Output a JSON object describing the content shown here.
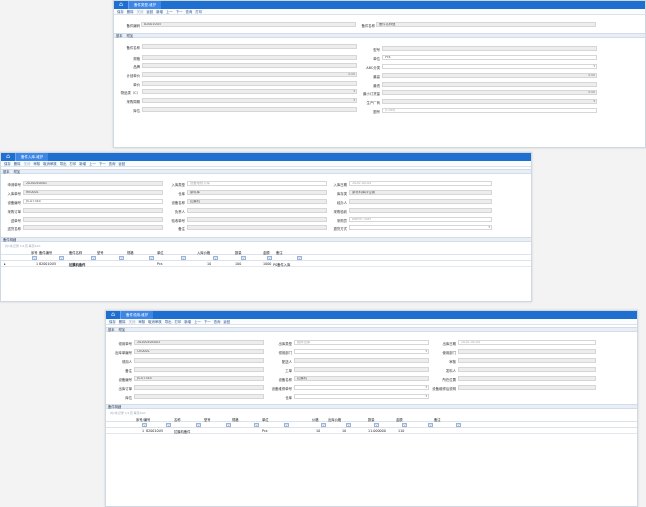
{
  "w1": {
    "tab": "备件类型-维护",
    "toolbar": [
      "保存",
      "删除",
      "关闭",
      "返回",
      "新增",
      "上一",
      "下一",
      "查询",
      "打印"
    ],
    "header": {
      "code_label": "备件编码",
      "code_value": "820010U5",
      "name_label": "备件名称",
      "name_value": "备件名称值"
    },
    "tabs": [
      "基本",
      "附加"
    ],
    "fields": {
      "l1": "备件名称",
      "l2": "规格",
      "l3": "品牌",
      "l4": "计划单价",
      "l5": "单价",
      "l6": "物品类（C）",
      "l7": "采购周期",
      "l8": "库位",
      "r1": "型号",
      "r2": "单位",
      "r3": "ABC分类",
      "r4": "最高",
      "r5": "最低",
      "r6": "最小订货量",
      "r7": "生产厂商",
      "r8": "图号",
      "r2v": "Pcs",
      "l4v": "0.00",
      "r4v": "0.00",
      "r6v": "0.00",
      "r8v": "(Char)"
    }
  },
  "w2": {
    "tab": "备件入库-维护",
    "toolbar": [
      "保存",
      "删除",
      "关闭",
      "审核",
      "取消审核",
      "导出",
      "打印",
      "新增",
      "上一",
      "下一",
      "查询",
      "返回"
    ],
    "tabs": [
      "基本",
      "附加"
    ],
    "fields": {
      "a1": "申请单号",
      "a1v": "2020040001",
      "b1": "入库类型",
      "b1v": "设备维修入库",
      "c1": "入库日期",
      "c1v": "2020-04-04",
      "a2": "入库单号",
      "a2v": "RK0001",
      "b2": "仓库",
      "b2v": "原料库",
      "c2": "库存类",
      "c2v": "原材料库存位置",
      "a3": "设备编号",
      "a3v": "JS-07344",
      "b3": "设备名称",
      "b3v": "拉膜机",
      "c3": "经办人",
      "a4": "采购订单",
      "b4": "负责人",
      "c4": "采购验收",
      "a5": "送单号",
      "b5": "验收单号",
      "c5": "采购员",
      "c5v": "Admin User",
      "a6": "送货名称",
      "b6": "备注",
      "c6": "退货方式"
    },
    "grid": {
      "title": "备件明细",
      "hint": "共1条记录  1/1页  每页100",
      "cols": [
        "序号",
        "备件编号",
        "备件名称",
        "型号",
        "规格",
        "单位",
        "入库价格",
        "数量",
        "金额",
        "备注"
      ],
      "row": {
        "seq": "1",
        "code": "820010U5",
        "name": "拉膜机备件",
        "unit": "Pcs",
        "price": "10",
        "qty": "100",
        "amount": "1000",
        "remark": "PS备件入库"
      }
    }
  },
  "w3": {
    "tab": "备件领用-维护",
    "toolbar": [
      "保存",
      "删除",
      "关闭",
      "审核",
      "取消审核",
      "导出",
      "打印",
      "新增",
      "上一",
      "下一",
      "查询",
      "返回"
    ],
    "tabs": [
      "基本",
      "附加"
    ],
    "fields": {
      "a1": "领用单号",
      "a1v": "20200404003",
      "b1": "出库类型",
      "b1v": "维修出库",
      "c1": "出库日期",
      "c1v": "2020-04-04",
      "a2": "出库单编号",
      "a2v": "CK0001",
      "b2": "领用部门",
      "c2": "使用部门",
      "a3": "领用人",
      "b3": "配送人",
      "c3": "审核",
      "a4": "备注",
      "b4": "工单",
      "c4": "发料人",
      "a5": "设备编号",
      "a5v": "JS-07344",
      "b5": "设备名称",
      "b5v": "拉膜机",
      "c5": "所在位置",
      "a6": "出库订单",
      "b6": "设备维修单号",
      "c6": "设备维修后说明",
      "a7": "库位",
      "b7": "仓库"
    },
    "grid": {
      "title": "备件明细",
      "hint": "共1条记录  1/1页  每页100",
      "cols": [
        "序号/编号",
        "名称",
        "型号",
        "规格",
        "单位",
        "价格",
        "出库价格",
        "数量",
        "金额",
        "备注"
      ],
      "row": {
        "seq": "1",
        "code": "820010U5",
        "name": "拉膜机备件",
        "unit": "Pcs",
        "price": "10",
        "price2": "10",
        "qty": "11.000000",
        "amount": "110"
      }
    }
  }
}
